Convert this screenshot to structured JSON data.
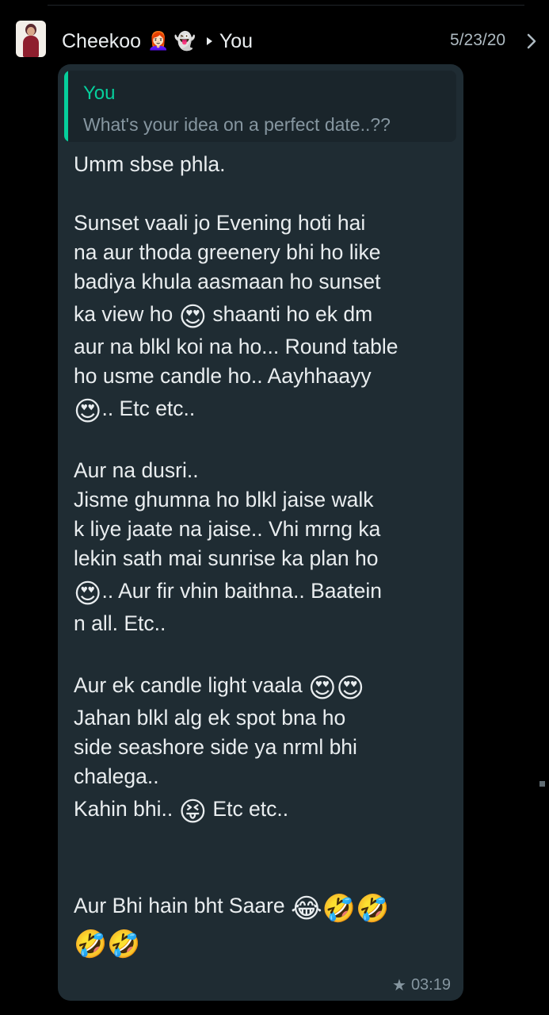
{
  "header": {
    "sender": "Cheekoo",
    "sender_emojis": [
      "👩🏻‍🦰",
      "👻"
    ],
    "recipient": "You",
    "date": "5/23/20"
  },
  "quote": {
    "author": "You",
    "text": "What's your idea on a perfect date..??"
  },
  "message": {
    "l1": "Umm sbse phla.",
    "l2": "Sunset vaali jo Evening hoti hai",
    "l3": "na aur thoda greenery bhi ho like",
    "l4": "badiya khula aasmaan ho sunset",
    "l5a": "ka view ho ",
    "l5e": "😍",
    "l5b": " shaanti ho ek dm",
    "l6": "aur na blkl koi na ho... Round table",
    "l7": "ho usme candle ho.. Aayhhaayy",
    "l8e": "😍",
    "l8b": ".. Etc etc..",
    "l9": "Aur na dusri..",
    "l10": " Jisme ghumna ho blkl jaise walk",
    "l11": "k liye jaate na jaise.. Vhi mrng ka",
    "l12": "lekin sath mai sunrise ka plan ho",
    "l13e": "😍",
    "l13b": "..  Aur fir vhin baithna.. Baatein",
    "l14": "n all. Etc..",
    "l15a": "Aur ek candle light vaala ",
    "l15e": "😍😍",
    "l16": "Jahan blkl alg ek spot bna ho",
    "l17": "side seashore side ya nrml bhi",
    "l18": "chalega..",
    "l19a": "Kahin bhi.. ",
    "l19e": "😝",
    "l19b": " Etc etc..",
    "l20a": "Aur Bhi hain bht Saare ",
    "l20e": "😂🤣🤣",
    "l21e": "🤣🤣"
  },
  "meta": {
    "starred": true,
    "time": "03:19"
  },
  "colors": {
    "background": "#000000",
    "bubble": "#1f2c33",
    "accent": "#06cf9c",
    "text": "#e9edef",
    "muted": "#8696a0"
  },
  "icons": {
    "star": "star-icon",
    "chevron": "chevron-right-icon",
    "arrow": "play-arrow-icon"
  }
}
